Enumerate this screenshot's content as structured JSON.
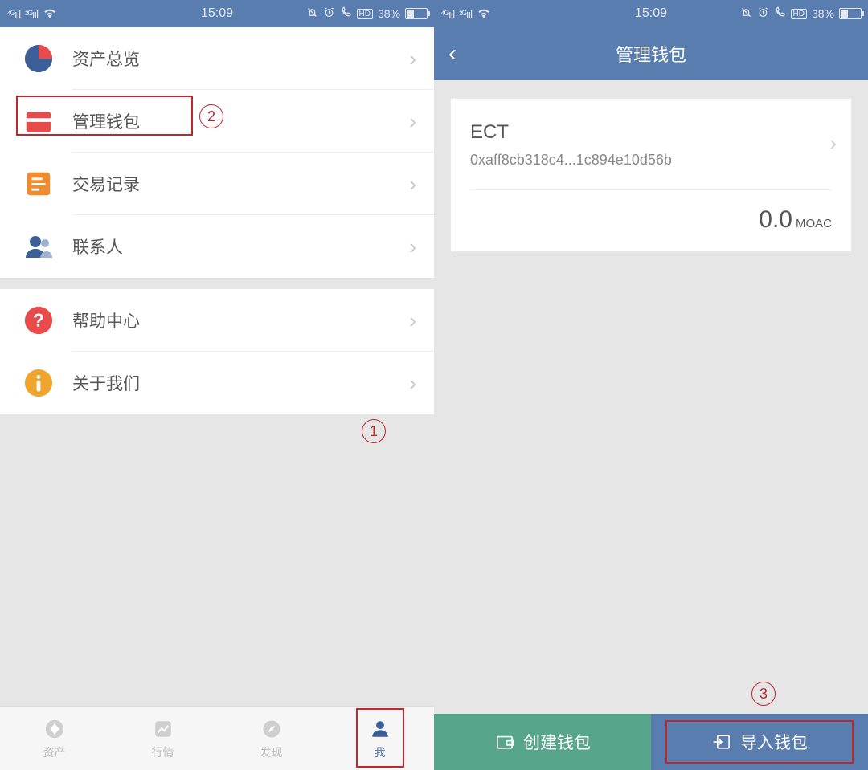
{
  "status": {
    "time": "15:09",
    "battery_pct": "38%",
    "hd": "HD"
  },
  "screen1": {
    "menu": {
      "assets_overview": "资产总览",
      "manage_wallet": "管理钱包",
      "tx_history": "交易记录",
      "contacts": "联系人",
      "help_center": "帮助中心",
      "about_us": "关于我们"
    },
    "tabs": {
      "assets": "资产",
      "market": "行情",
      "discover": "发现",
      "me": "我"
    },
    "annot": {
      "one": "1",
      "two": "2"
    }
  },
  "screen2": {
    "header_title": "管理钱包",
    "wallet": {
      "name": "ECT",
      "address": "0xaff8cb318c4...1c894e10d56b",
      "balance": "0.0",
      "unit": "MOAC"
    },
    "buttons": {
      "create": "创建钱包",
      "import": "导入钱包"
    },
    "annot": {
      "three": "3"
    }
  }
}
